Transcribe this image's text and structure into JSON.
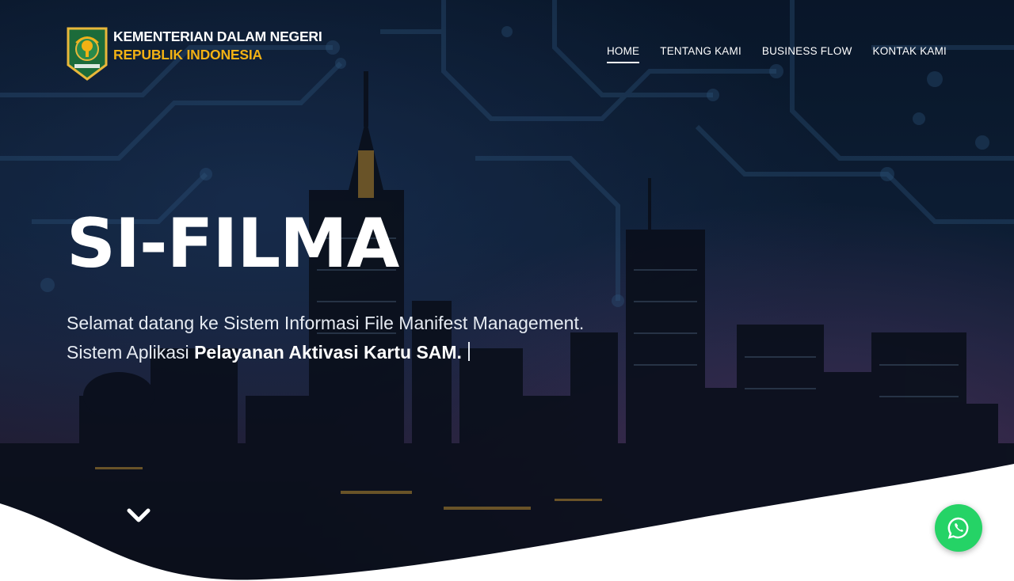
{
  "header": {
    "logo_icon": "garuda-emblem-icon",
    "brand_line1": "KEMENTERIAN DALAM NEGERI",
    "brand_line2": "REPUBLIK INDONESIA",
    "nav": [
      {
        "label": "HOME",
        "active": true
      },
      {
        "label": "TENTANG KAMI",
        "active": false
      },
      {
        "label": "BUSINESS FLOW",
        "active": false
      },
      {
        "label": "KONTAK KAMI",
        "active": false
      }
    ]
  },
  "hero": {
    "title": "SI-FILMA",
    "line1": "Selamat datang ke Sistem Informasi File Manifest Management.",
    "line2_prefix": "Sistem Aplikasi ",
    "line2_bold": "Pelayanan Aktivasi Kartu SAM.",
    "scroll_icon": "chevron-down-icon"
  },
  "floating": {
    "whatsapp_icon": "whatsapp-icon"
  },
  "colors": {
    "brand_accent": "#f2b114",
    "whatsapp": "#25d366"
  }
}
